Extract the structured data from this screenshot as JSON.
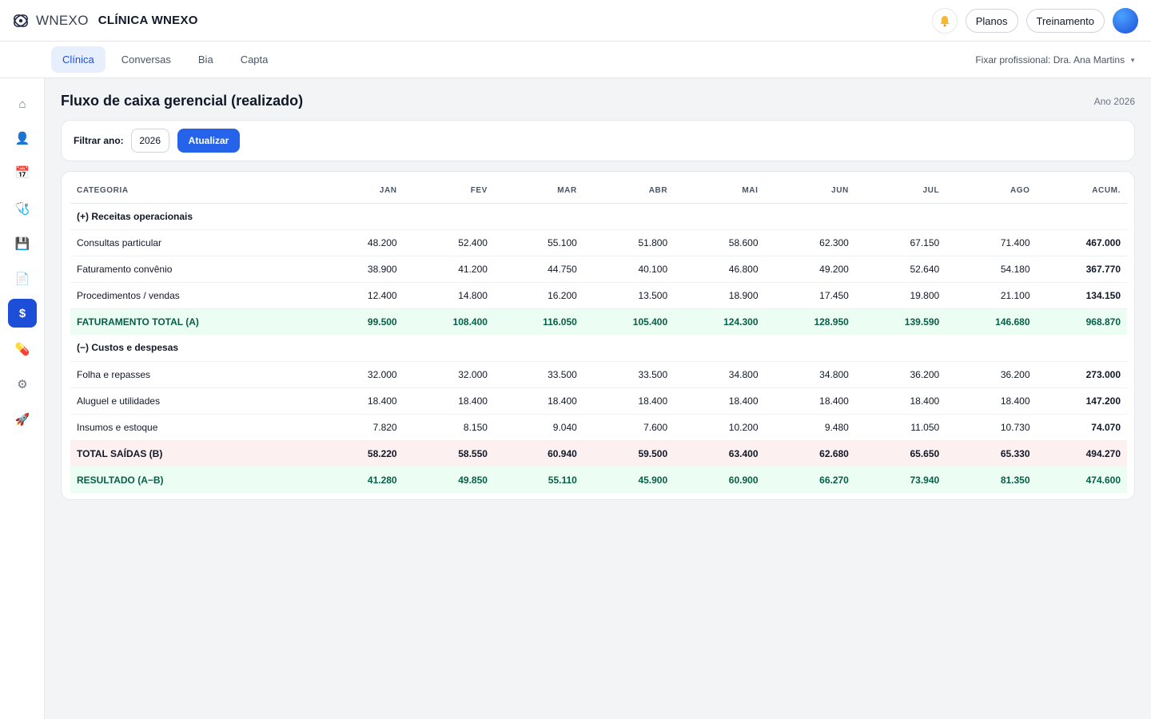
{
  "brand": {
    "logo_text": "WNEXO",
    "clinic_name": "CLÍNICA WNEXO"
  },
  "header": {
    "plans_label": "Planos",
    "training_label": "Treinamento"
  },
  "subnav": {
    "tabs": [
      {
        "label": "Clínica",
        "active": true
      },
      {
        "label": "Conversas",
        "active": false
      },
      {
        "label": "Bia",
        "active": false
      },
      {
        "label": "Capta",
        "active": false
      }
    ],
    "pin_professional": "Fixar profissional: Dra. Ana Martins"
  },
  "sidebar": {
    "items": [
      {
        "name": "home-icon",
        "glyph": "⌂"
      },
      {
        "name": "patients-icon",
        "glyph": "👤"
      },
      {
        "name": "calendar-icon",
        "glyph": "📅"
      },
      {
        "name": "stethoscope-icon",
        "glyph": "🩺"
      },
      {
        "name": "records-icon",
        "glyph": "💾"
      },
      {
        "name": "document-icon",
        "glyph": "📄"
      },
      {
        "name": "dollar-icon",
        "glyph": "$",
        "active": true
      },
      {
        "name": "pill-icon",
        "glyph": "💊"
      },
      {
        "name": "settings-icon",
        "glyph": "⚙"
      },
      {
        "name": "rocket-icon",
        "glyph": "🚀"
      }
    ]
  },
  "page": {
    "title": "Fluxo de caixa gerencial (realizado)",
    "year_label": "Ano 2026"
  },
  "filter": {
    "label": "Filtrar ano:",
    "year_value": "2026",
    "button_label": "Atualizar"
  },
  "table": {
    "columns": [
      "CATEGORIA",
      "JAN",
      "FEV",
      "MAR",
      "ABR",
      "MAI",
      "JUN",
      "JUL",
      "AGO",
      "ACUM."
    ],
    "rows": [
      {
        "kind": "section",
        "label": "(+) Receitas operacionais",
        "values": [
          "",
          "",
          "",
          "",
          "",
          "",
          "",
          ""
        ],
        "acc": ""
      },
      {
        "kind": "normal",
        "label": "Consultas particular",
        "values": [
          "48.200",
          "52.400",
          "55.100",
          "51.800",
          "58.600",
          "62.300",
          "67.150",
          "71.400"
        ],
        "acc": "467.000"
      },
      {
        "kind": "normal",
        "label": "Faturamento convênio",
        "values": [
          "38.900",
          "41.200",
          "44.750",
          "40.100",
          "46.800",
          "49.200",
          "52.640",
          "54.180"
        ],
        "acc": "367.770"
      },
      {
        "kind": "normal",
        "label": "Procedimentos / vendas",
        "values": [
          "12.400",
          "14.800",
          "16.200",
          "13.500",
          "18.900",
          "17.450",
          "19.800",
          "21.100"
        ],
        "acc": "134.150"
      },
      {
        "kind": "total-a",
        "label": "FATURAMENTO TOTAL (A)",
        "values": [
          "99.500",
          "108.400",
          "116.050",
          "105.400",
          "124.300",
          "128.950",
          "139.590",
          "146.680"
        ],
        "acc": "968.870"
      },
      {
        "kind": "section",
        "label": "(−) Custos e despesas",
        "values": [
          "",
          "",
          "",
          "",
          "",
          "",
          "",
          ""
        ],
        "acc": ""
      },
      {
        "kind": "normal",
        "label": "Folha e repasses",
        "values": [
          "32.000",
          "32.000",
          "33.500",
          "33.500",
          "34.800",
          "34.800",
          "36.200",
          "36.200"
        ],
        "acc": "273.000"
      },
      {
        "kind": "normal",
        "label": "Aluguel e utilidades",
        "values": [
          "18.400",
          "18.400",
          "18.400",
          "18.400",
          "18.400",
          "18.400",
          "18.400",
          "18.400"
        ],
        "acc": "147.200"
      },
      {
        "kind": "normal",
        "label": "Insumos e estoque",
        "values": [
          "7.820",
          "8.150",
          "9.040",
          "7.600",
          "10.200",
          "9.480",
          "11.050",
          "10.730"
        ],
        "acc": "74.070"
      },
      {
        "kind": "total-b",
        "label": "TOTAL SAÍDAS (B)",
        "values": [
          "58.220",
          "58.550",
          "60.940",
          "59.500",
          "63.400",
          "62.680",
          "65.650",
          "65.330"
        ],
        "acc": "494.270"
      },
      {
        "kind": "result",
        "label": "RESULTADO (A−B)",
        "values": [
          "41.280",
          "49.850",
          "55.110",
          "45.900",
          "60.900",
          "66.270",
          "73.940",
          "81.350"
        ],
        "acc": "474.600"
      }
    ]
  }
}
